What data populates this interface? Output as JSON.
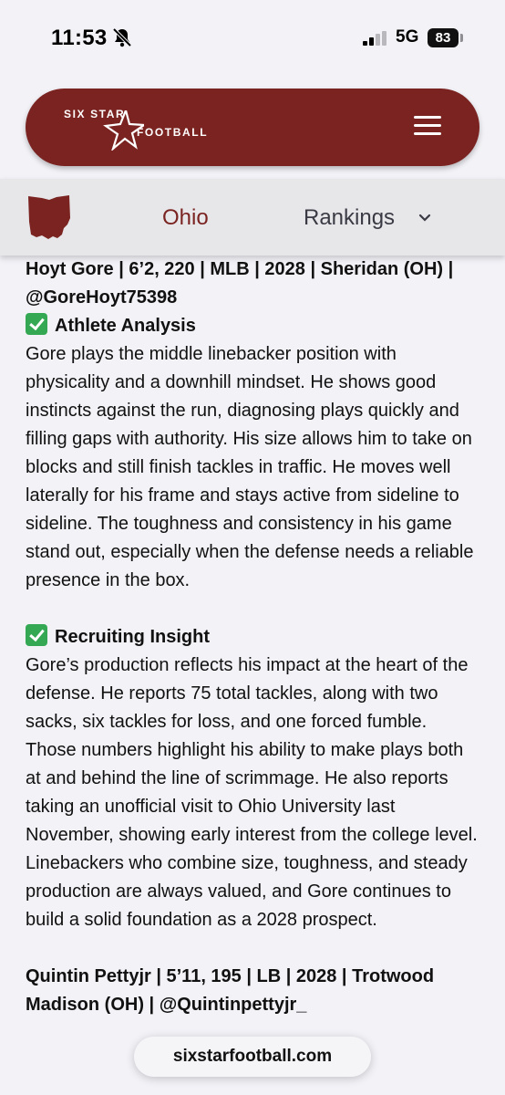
{
  "status_bar": {
    "time": "11:53",
    "network": "5G",
    "battery": "83"
  },
  "header": {
    "logo_top": "SIX STAR",
    "logo_bottom": "FOOTBALL",
    "brand_color": "#7a2320"
  },
  "nav": {
    "state_label": "Ohio",
    "rankings_label": "Rankings"
  },
  "article": {
    "player_line": "Hoyt Gore | 6’2, 220 | MLB | 2028 | Sheridan (OH) | @GoreHoyt75398",
    "section1_title": "Athlete Analysis",
    "section1_body": "Gore plays the middle linebacker position with physicality and a downhill mindset. He shows good instincts against the run, diagnosing plays quickly and filling gaps with authority. His size allows him to take on blocks and still finish tackles in traffic. He moves well laterally for his frame and stays active from sideline to sideline. The toughness and consistency in his game stand out, especially when the defense needs a reliable presence in the box.",
    "section2_title": "Recruiting Insight",
    "section2_body": "Gore’s production reflects his impact at the heart of the defense. He reports 75 total tackles, along with two sacks, six tackles for loss, and one forced fumble. Those numbers highlight his ability to make plays both at and behind the line of scrimmage. He also reports taking an unofficial visit to Ohio University last November, showing early interest from the college level. Linebackers who combine size, toughness, and steady production are always valued, and Gore continues to build a solid foundation as a 2028 prospect.",
    "next_player_line": "Quintin Pettyjr | 5’11, 195 | LB | 2028 | Trotwood Madison (OH) | @Quintinpettyjr_"
  },
  "browser": {
    "url": "sixstarfootball.com"
  }
}
